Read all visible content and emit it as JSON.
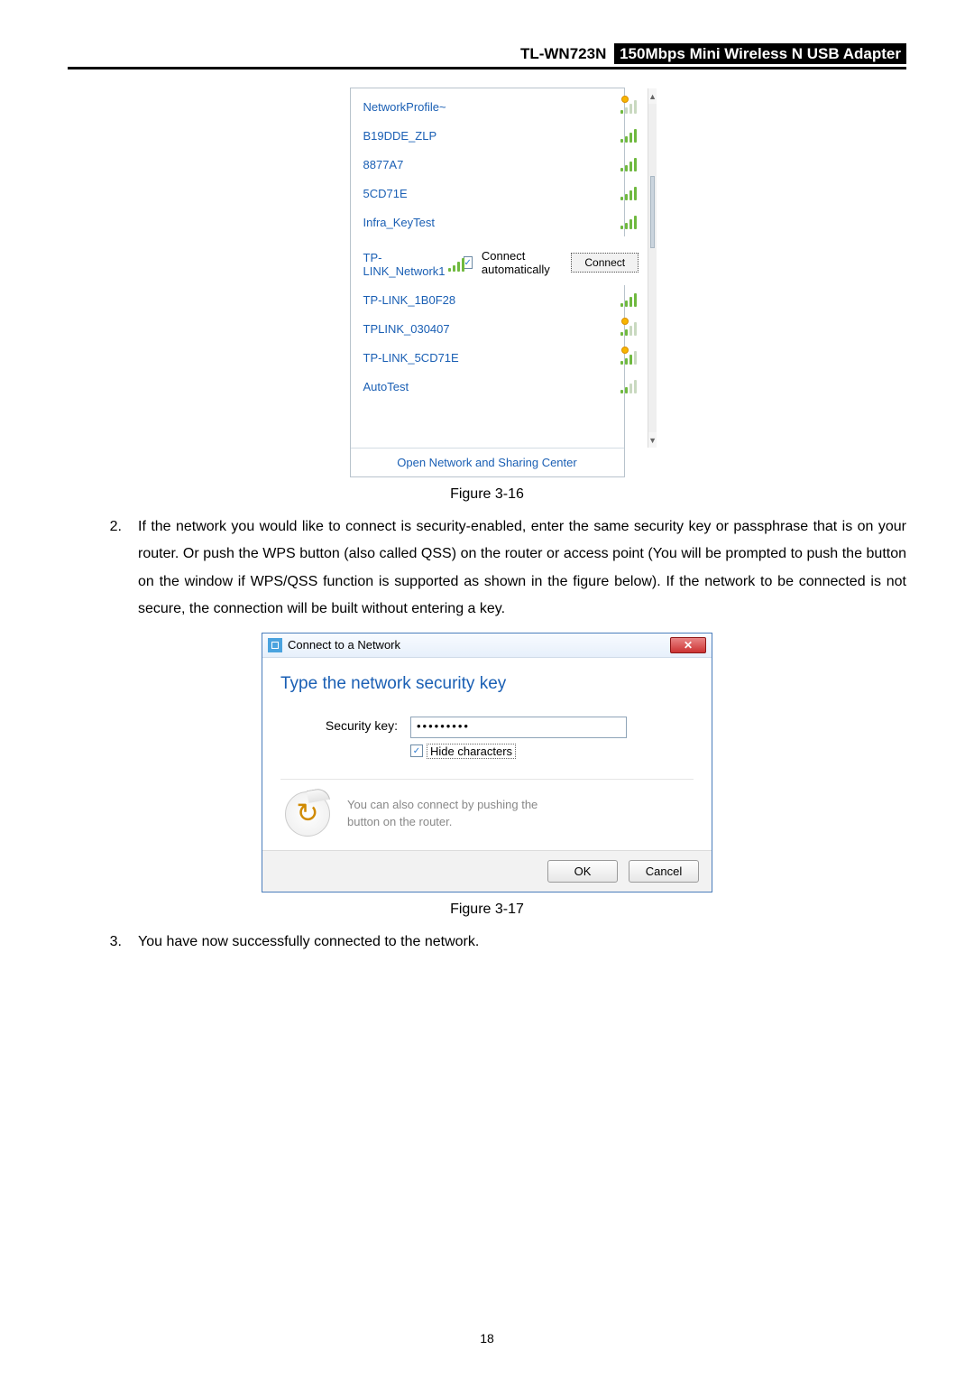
{
  "header": {
    "model": "TL-WN723N",
    "tagline": "150Mbps Mini Wireless N USB Adapter"
  },
  "wifi_popup": {
    "networks": [
      {
        "name": "NetworkProfile~",
        "secured": true,
        "strength": 1
      },
      {
        "name": "B19DDE_ZLP",
        "secured": false,
        "strength": 4
      },
      {
        "name": "8877A7",
        "secured": false,
        "strength": 4
      },
      {
        "name": "5CD71E",
        "secured": false,
        "strength": 4
      },
      {
        "name": "Infra_KeyTest",
        "secured": false,
        "strength": 4
      },
      {
        "name": "TP-LINK_Network1",
        "secured": false,
        "strength": 4,
        "selected": true
      },
      {
        "name": "TP-LINK_1B0F28",
        "secured": false,
        "strength": 4
      },
      {
        "name": "TPLINK_030407",
        "secured": true,
        "strength": 2
      },
      {
        "name": "TP-LINK_5CD71E",
        "secured": true,
        "strength": 3
      },
      {
        "name": "AutoTest",
        "secured": false,
        "strength": 2
      }
    ],
    "connect_auto_label": "Connect automatically",
    "connect_auto_checked": true,
    "connect_btn": "Connect",
    "footer_link": "Open Network and Sharing Center"
  },
  "figure_caption_1": "Figure 3-16",
  "step2": {
    "num": "2.",
    "text": "If the network you would like to connect is security-enabled, enter the same security key or passphrase that is on your router. Or push the WPS button (also called QSS) on the router or access point (You will be prompted to push the button on the window if WPS/QSS function is supported as shown in the figure below). If the network to be connected is not secure, the connection will be built without entering a key."
  },
  "dialog": {
    "title": "Connect to a Network",
    "headline": "Type the network security key",
    "label_security_key": "Security key:",
    "password_mask": "•••••••••",
    "hide_chars_label": "Hide characters",
    "hide_chars_checked": true,
    "wps_text_line1": "You can also connect by pushing the",
    "wps_text_line2": "button on the router.",
    "ok_label": "OK",
    "cancel_label": "Cancel"
  },
  "figure_caption_2": "Figure 3-17",
  "step3": {
    "num": "3.",
    "text": "You have now successfully connected to the network."
  },
  "page_number": "18"
}
